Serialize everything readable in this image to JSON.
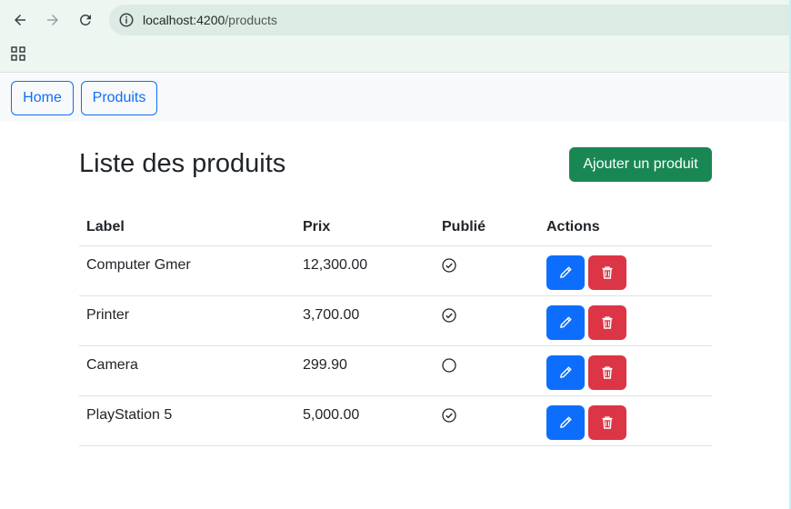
{
  "browser": {
    "url_host": "localhost:4200",
    "url_path": "/products",
    "icons": [
      "back-arrow-icon",
      "forward-arrow-icon",
      "reload-icon",
      "site-info-icon",
      "apps-grid-icon"
    ]
  },
  "nav": {
    "home_label": "Home",
    "produits_label": "Produits"
  },
  "page": {
    "title": "Liste des produits",
    "add_button_label": "Ajouter un produit"
  },
  "table": {
    "headers": {
      "label": "Label",
      "prix": "Prix",
      "publie": "Publié",
      "actions": "Actions"
    },
    "rows": [
      {
        "label": "Computer Gmer",
        "prix": "12,300.00",
        "published": true
      },
      {
        "label": "Printer",
        "prix": "3,700.00",
        "published": true
      },
      {
        "label": "Camera",
        "prix": "299.90",
        "published": false
      },
      {
        "label": "PlayStation 5",
        "prix": "5,000.00",
        "published": true
      }
    ]
  },
  "colors": {
    "primary": "#0d6efd",
    "success": "#198754",
    "danger": "#dc3545"
  }
}
